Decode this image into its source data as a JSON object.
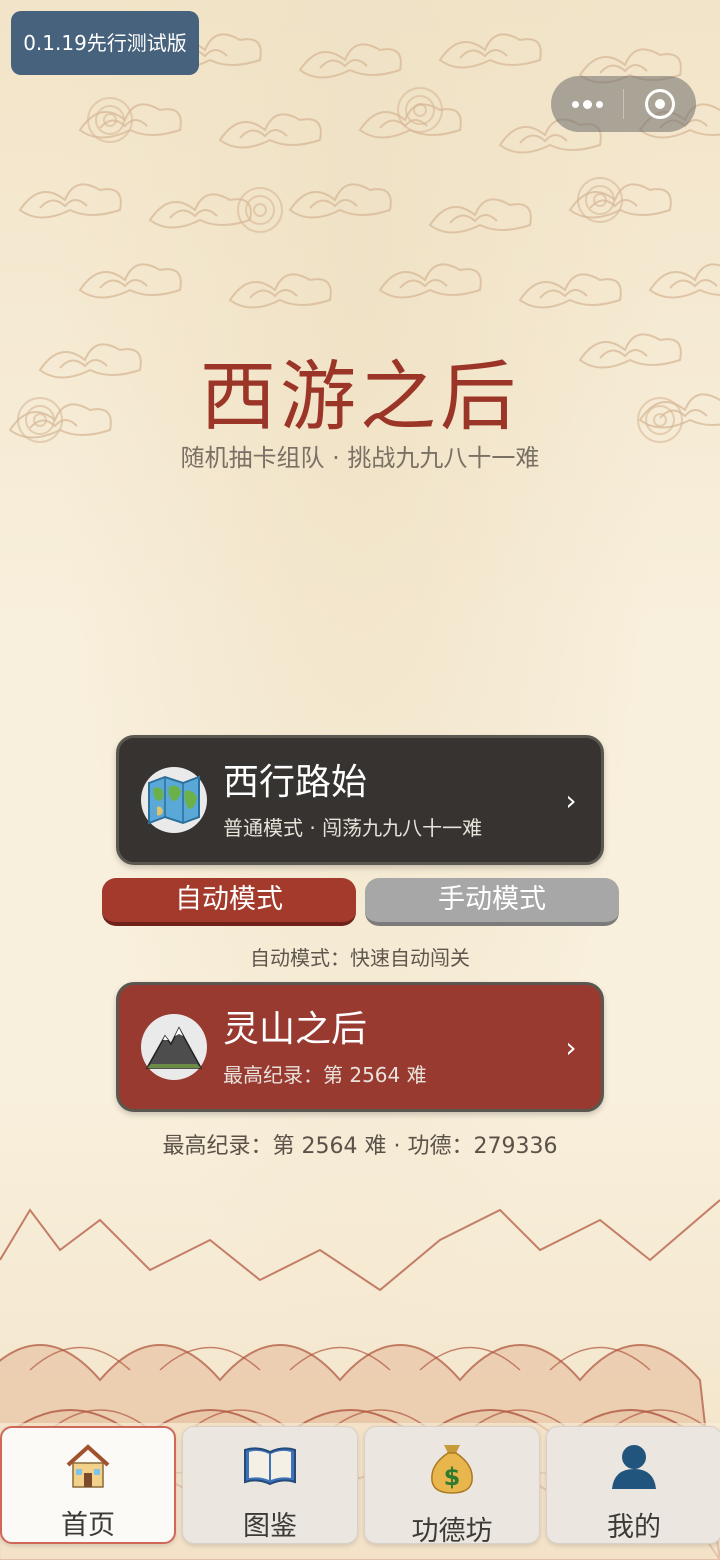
{
  "version_badge": "0.1.19先行测试版",
  "title": "西游之后",
  "subtitle": "随机抽卡组队 · 挑战九九八十一难",
  "journey_card": {
    "title": "西行路始",
    "subtitle": "普通模式 · 闯荡九九八十一难",
    "icon": "map-icon",
    "chevron": "›"
  },
  "mode_toggle": {
    "auto_label": "自动模式",
    "manual_label": "手动模式",
    "selected": "auto"
  },
  "mode_description": "自动模式：快速自动闯关",
  "lingshan_card": {
    "title": "灵山之后",
    "subtitle": "最高纪录：第 2564 难",
    "icon": "mountain-icon",
    "chevron": "›"
  },
  "record_summary": "最高纪录：第 2564 难 · 功德：279336",
  "tabs": [
    {
      "label": "首页",
      "icon": "house-icon",
      "active": true
    },
    {
      "label": "图鉴",
      "icon": "book-icon",
      "active": false
    },
    {
      "label": "功德坊",
      "icon": "money-bag-icon",
      "active": false
    },
    {
      "label": "我的",
      "icon": "user-icon",
      "active": false
    }
  ],
  "colors": {
    "title_red": "#9b3528",
    "dark_card": "#363330",
    "red_card": "#993a31",
    "badge_blue": "#47627c"
  }
}
